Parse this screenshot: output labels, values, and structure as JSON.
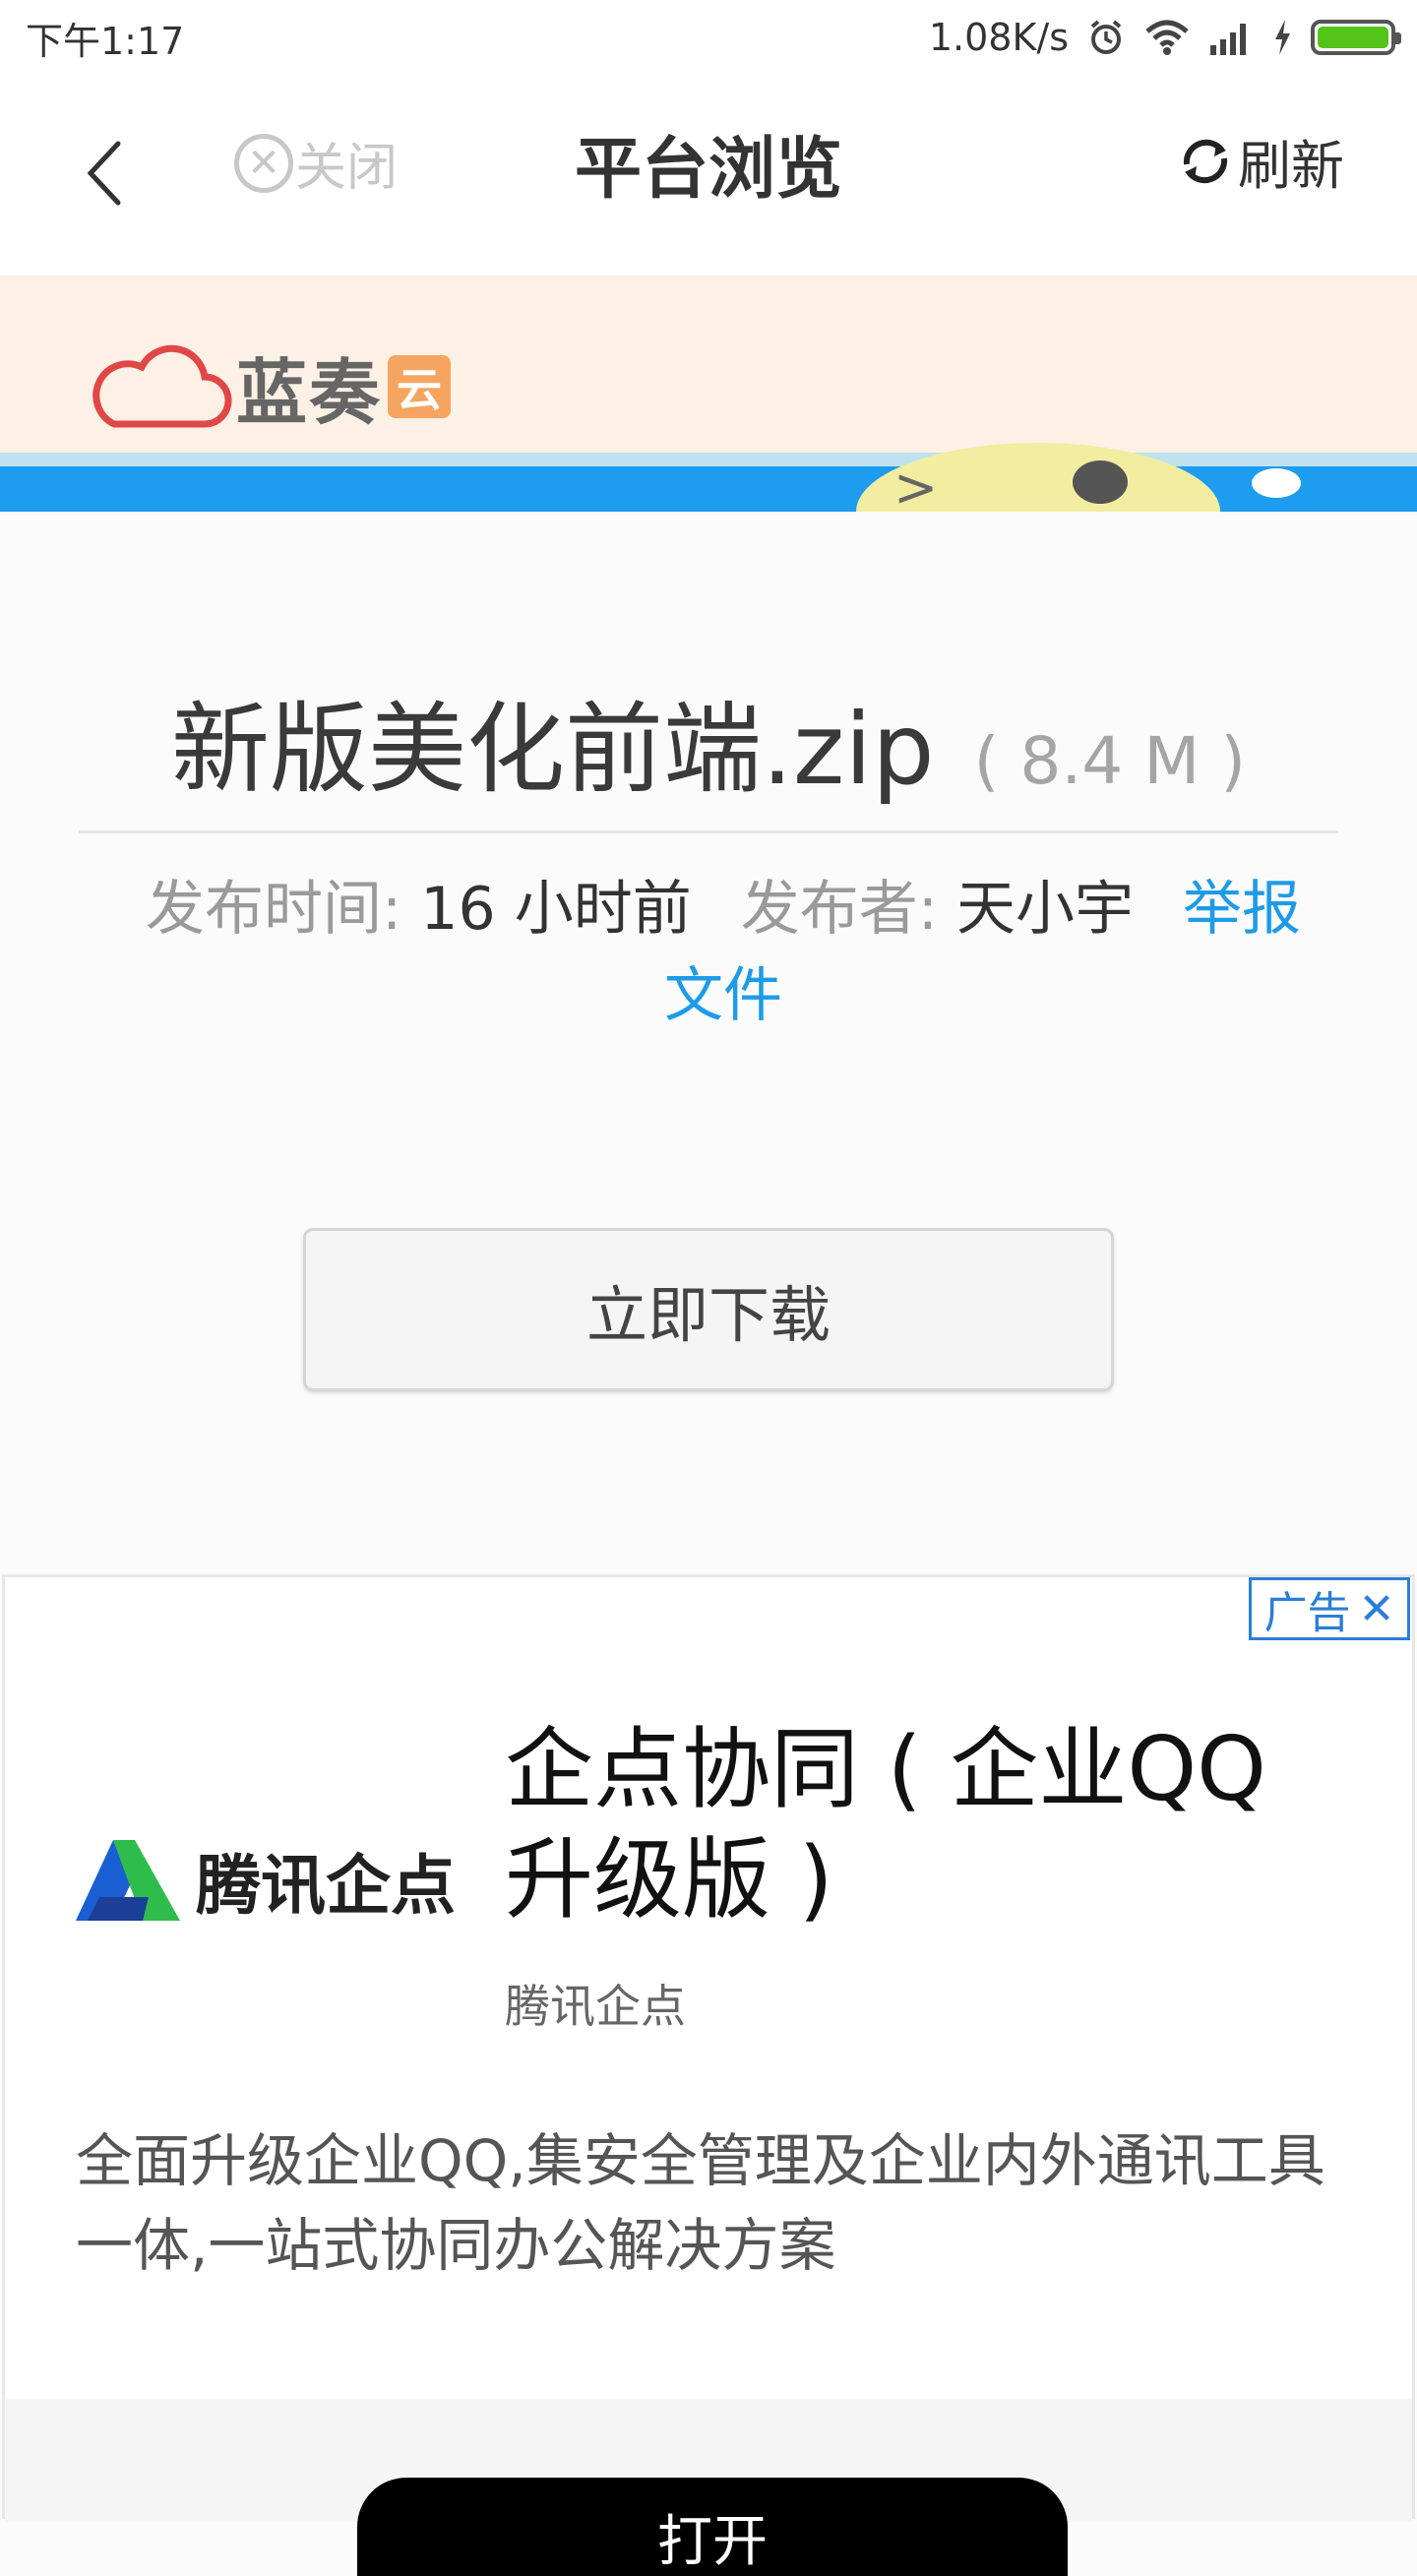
{
  "status_bar": {
    "time": "下午1:17",
    "speed": "1.08K/s",
    "icons": [
      "alarm-icon",
      "wifi-icon",
      "signal-icon",
      "charging-icon",
      "battery-icon"
    ],
    "battery_level": 1.0
  },
  "nav": {
    "close_label": "关闭",
    "title": "平台浏览",
    "refresh_label": "刷新"
  },
  "banner": {
    "logo_text": "蓝奏",
    "logo_badge": "云"
  },
  "file": {
    "name": "新版美化前端.zip",
    "size": "( 8.4 M )",
    "published_label": "发布时间:",
    "published_value": "16 小时前",
    "publisher_label": "发布者:",
    "publisher_value": "天小宇",
    "report_label": "举报文件"
  },
  "download_button": "立即下载",
  "ad": {
    "badge": "广告",
    "logo_text": "腾讯企点",
    "title": "企点协同 ( 企业QQ升级版 )",
    "subtitle": "腾讯企点",
    "description": "全面升级企业QQ,集安全管理及企业内外通讯工具一体,一站式协同办公解决方案",
    "open_button": "打开"
  },
  "colors": {
    "link": "#1e9be8",
    "ad_badge": "#2a7fd6",
    "banner_bg": "#fdf0e5",
    "banner_blue": "#1d9cf0"
  }
}
